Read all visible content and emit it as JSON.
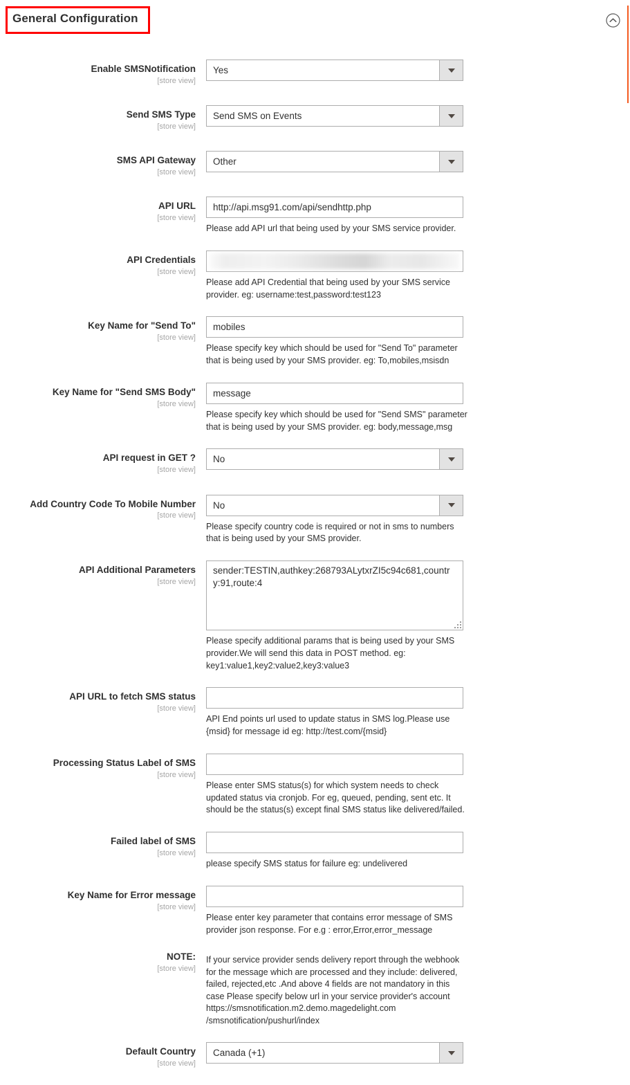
{
  "section": {
    "title": "General Configuration",
    "collapse_icon": "chevron-up-circle-icon",
    "annotation_color": "#ff0000",
    "edge_marker_color": "#f4591f"
  },
  "scope_label": "[store view]",
  "fields": [
    {
      "label": "Enable SMSNotification",
      "scope": "[store view]",
      "type": "select",
      "value": "Yes",
      "hint": ""
    },
    {
      "label": "Send SMS Type",
      "scope": "[store view]",
      "type": "select",
      "value": "Send SMS on Events",
      "hint": ""
    },
    {
      "label": "SMS API Gateway",
      "scope": "[store view]",
      "type": "select",
      "value": "Other",
      "hint": ""
    },
    {
      "label": "API URL",
      "scope": "[store view]",
      "type": "text",
      "value": "http://api.msg91.com/api/sendhttp.php",
      "hint": "Please add API url that being used by your SMS service provider."
    },
    {
      "label": "API Credentials",
      "scope": "[store view]",
      "type": "redacted",
      "value": "",
      "hint": "Please add API Credential that being used by your SMS service provider. eg: username:test,password:test123"
    },
    {
      "label": "Key Name for \"Send To\"",
      "scope": "[store view]",
      "type": "text",
      "value": "mobiles",
      "hint": "Please specify key which should be used for \"Send To\" parameter that is being used by your SMS provider. eg: To,mobiles,msisdn"
    },
    {
      "label": "Key Name for \"Send SMS Body\"",
      "scope": "[store view]",
      "type": "text",
      "value": "message",
      "hint": "Please specify key which should be used for \"Send SMS\" parameter that is being used by your SMS provider. eg: body,message,msg"
    },
    {
      "label": "API request in GET ?",
      "scope": "[store view]",
      "type": "select",
      "value": "No",
      "hint": ""
    },
    {
      "label": "Add Country Code To Mobile Number",
      "scope": "[store view]",
      "type": "select",
      "value": "No",
      "hint": "Please specify country code is required or not in sms to numbers that is being used by your SMS provider."
    },
    {
      "label": "API Additional Parameters",
      "scope": "[store view]",
      "type": "textarea",
      "value": "sender:TESTIN,authkey:268793ALytxrZI5c94c681,country:91,route:4",
      "hint": "Please specify additional params that is being used by your SMS provider.We will send this data in POST method. eg: key1:value1,key2:value2,key3:value3"
    },
    {
      "label": "API URL to fetch SMS status",
      "scope": "[store view]",
      "type": "text",
      "value": "",
      "hint": "API End points url used to update status in SMS log.Please use {msid} for message id eg: http://test.com/{msid}"
    },
    {
      "label": "Processing Status Label of SMS",
      "scope": "[store view]",
      "type": "text",
      "value": "",
      "hint": "Please enter SMS status(s) for which system needs to check updated status via cronjob. For eg, queued, pending, sent etc. It should be the status(s) except final SMS status like delivered/failed."
    },
    {
      "label": "Failed label of SMS",
      "scope": "[store view]",
      "type": "text",
      "value": "",
      "hint": "please specify SMS status for failure eg: undelivered"
    },
    {
      "label": "Key Name for Error message",
      "scope": "[store view]",
      "type": "text",
      "value": "",
      "hint": "Please enter key parameter that contains error message of SMS provider json response. For e.g : error,Error,error_message"
    },
    {
      "label": "NOTE:",
      "scope": "[store view]",
      "type": "note",
      "value": "If your service provider sends delivery report through the webhook for the message which are processed and they include: delivered, failed, rejected,etc .And above 4 fields are not mandatory in this case Please specify below url in your service provider's account https://smsnotification.m2.demo.magedelight.com /smsnotification/pushurl/index",
      "hint": ""
    },
    {
      "label": "Default Country",
      "scope": "[store view]",
      "type": "select",
      "value": "Canada (+1)",
      "hint": ""
    }
  ]
}
